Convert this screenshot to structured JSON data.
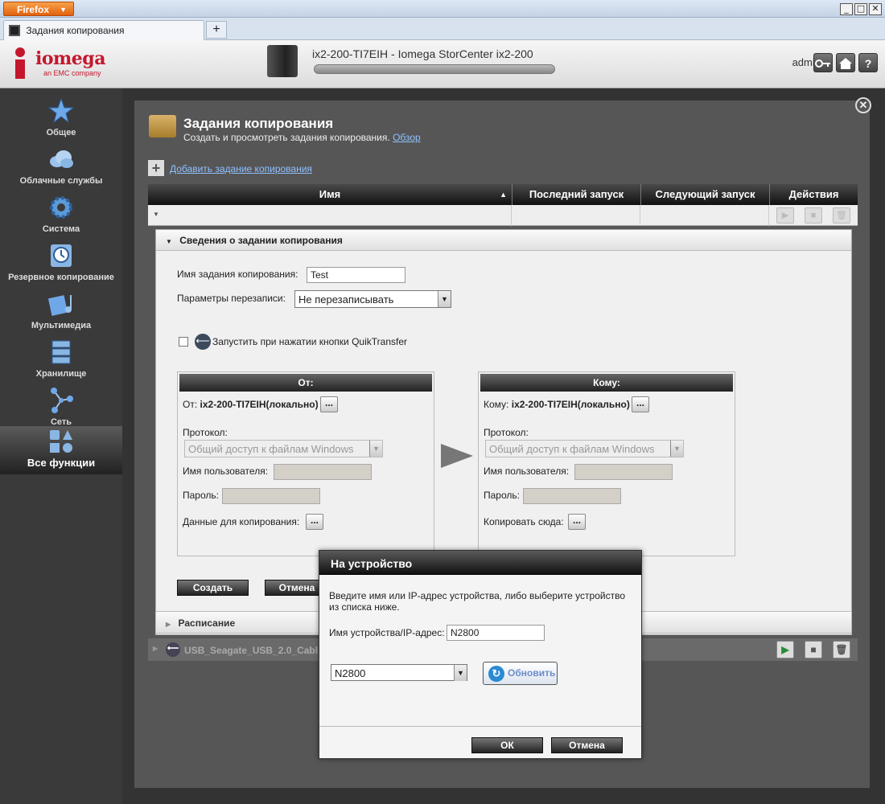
{
  "browser": {
    "firefox_label": "Firefox",
    "tab_title": "Задания копирования",
    "new_tab": "+",
    "win_min": "_",
    "win_max": "□",
    "win_close": "✕"
  },
  "header": {
    "logo_name": "iomega",
    "logo_sub": "an EMC company",
    "device_title": "ix2-200-TI7EIH - Iomega StorCenter ix2-200",
    "user": "admin"
  },
  "sidebar": {
    "items": [
      {
        "label": "Общее",
        "icon": "star-icon"
      },
      {
        "label": "Облачные службы",
        "icon": "cloud-icon"
      },
      {
        "label": "Система",
        "icon": "gear-icon"
      },
      {
        "label": "Резервное копирование",
        "icon": "backup-clock-icon"
      },
      {
        "label": "Мультимедиа",
        "icon": "multimedia-icon"
      },
      {
        "label": "Хранилище",
        "icon": "storage-icon"
      },
      {
        "label": "Сеть",
        "icon": "network-icon"
      },
      {
        "label": "Все функции",
        "icon": "all-features-icon"
      }
    ]
  },
  "page": {
    "title": "Задания копирования",
    "subtitle": "Создать и просмотреть задания копирования.",
    "overview_link": "Обзор",
    "add_link": "Добавить задание копирования"
  },
  "table": {
    "columns": [
      "Имя",
      "Последний запуск",
      "Следующий запуск",
      "Действия"
    ]
  },
  "details": {
    "section_title": "Сведения о задании копирования",
    "job_name_label": "Имя задания копирования:",
    "job_name_value": "Test",
    "overwrite_label": "Параметры перезаписи:",
    "overwrite_value": "Не перезаписывать",
    "quiktransfer_label": "Запустить при нажатии кнопки QuikTransfer",
    "from": {
      "header": "От:",
      "source_prefix": "От:",
      "source_value": "ix2-200-TI7EIH(локально)",
      "protocol_label": "Протокол:",
      "protocol_value": "Общий доступ к файлам Windows",
      "username_label": "Имя пользователя:",
      "password_label": "Пароль:",
      "data_label": "Данные для копирования:"
    },
    "to": {
      "header": "Кому:",
      "dest_prefix": "Кому:",
      "dest_value": "ix2-200-TI7EIH(локально)",
      "protocol_label": "Протокол:",
      "protocol_value": "Общий доступ к файлам Windows",
      "username_label": "Имя пользователя:",
      "password_label": "Пароль:",
      "copy_here_label": "Копировать сюда:"
    },
    "dots": "...",
    "create_button": "Создать",
    "cancel_button": "Отмена",
    "schedule_title": "Расписание"
  },
  "usb_row": {
    "name": "USB_Seagate_USB_2.0_Cabl"
  },
  "modal": {
    "title": "На устройство",
    "instructions": "Введите имя или IP-адрес устройства, либо выберите устройство из списка ниже.",
    "device_label": "Имя устройства/IP-адрес:",
    "device_value": "N2800",
    "device_select_value": "N2800",
    "refresh_button": "Обновить",
    "ok_button": "ОК",
    "cancel_button": "Отмена"
  }
}
